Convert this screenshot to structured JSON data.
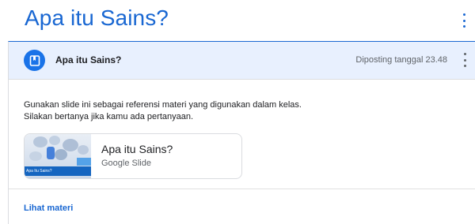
{
  "page": {
    "title": "Apa itu Sains?"
  },
  "post": {
    "title": "Apa itu Sains?",
    "date": "Diposting tanggal 23.48",
    "description": [
      "Gunakan slide ini sebagai referensi materi yang digunakan dalam kelas.",
      "Silakan bertanya jika kamu ada pertanyaan."
    ],
    "attachment": {
      "title": "Apa itu Sains?",
      "type": "Google Slide",
      "thumbnail_caption": "Apa Itu Sains?"
    },
    "footer_link": "Lihat materi"
  },
  "icons": {
    "avatar": "material-icon",
    "page_menu": "more-vert-icon",
    "post_menu": "more-vert-icon"
  },
  "colors": {
    "accent": "#1967d2",
    "header_bg": "#e8f0fe",
    "avatar_bg": "#1a73e8"
  }
}
